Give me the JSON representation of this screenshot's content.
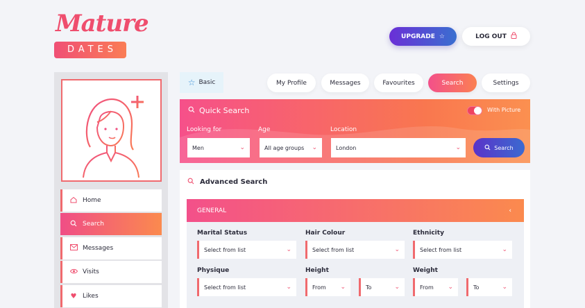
{
  "brand": {
    "script": "Mature",
    "sub": "DATES"
  },
  "header": {
    "upgrade_label": "UPGRADE",
    "logout_label": "LOG OUT"
  },
  "sidebar": {
    "items": [
      {
        "label": "Home",
        "icon": "home-icon"
      },
      {
        "label": "Search",
        "icon": "search-icon",
        "active": true
      },
      {
        "label": "Messages",
        "icon": "envelope-icon"
      },
      {
        "label": "Visits",
        "icon": "eye-icon"
      },
      {
        "label": "Likes",
        "icon": "heart-icon"
      }
    ]
  },
  "tabs": {
    "basic": "Basic",
    "items": [
      "My Profile",
      "Messages",
      "Favourites",
      "Search",
      "Settings"
    ],
    "active": "Search"
  },
  "quick_search": {
    "title": "Quick Search",
    "with_picture_label": "With Picture",
    "with_picture_on": true,
    "looking_for_label": "Looking for",
    "looking_for_value": "Men",
    "age_label": "Age",
    "age_value": "All age groups",
    "location_label": "Location",
    "location_value": "London",
    "search_button": "Search"
  },
  "advanced_search": {
    "title": "Advanced Search",
    "section": "GENERAL",
    "fields": {
      "marital_status": {
        "label": "Marital Status",
        "value": "Select from list"
      },
      "hair_colour": {
        "label": "Hair Colour",
        "value": "Select from list"
      },
      "ethnicity": {
        "label": "Ethnicity",
        "value": "Select from list"
      },
      "physique": {
        "label": "Physique",
        "value": "Select from list"
      },
      "height": {
        "label": "Height",
        "from": "From",
        "to": "To"
      },
      "weight": {
        "label": "Weight",
        "from": "From",
        "to": "To"
      }
    }
  },
  "colors": {
    "accent": "#ef4e6e",
    "gradient_start": "#f3508a",
    "gradient_end": "#fb8a4e",
    "purple": "#6a2fd6"
  }
}
